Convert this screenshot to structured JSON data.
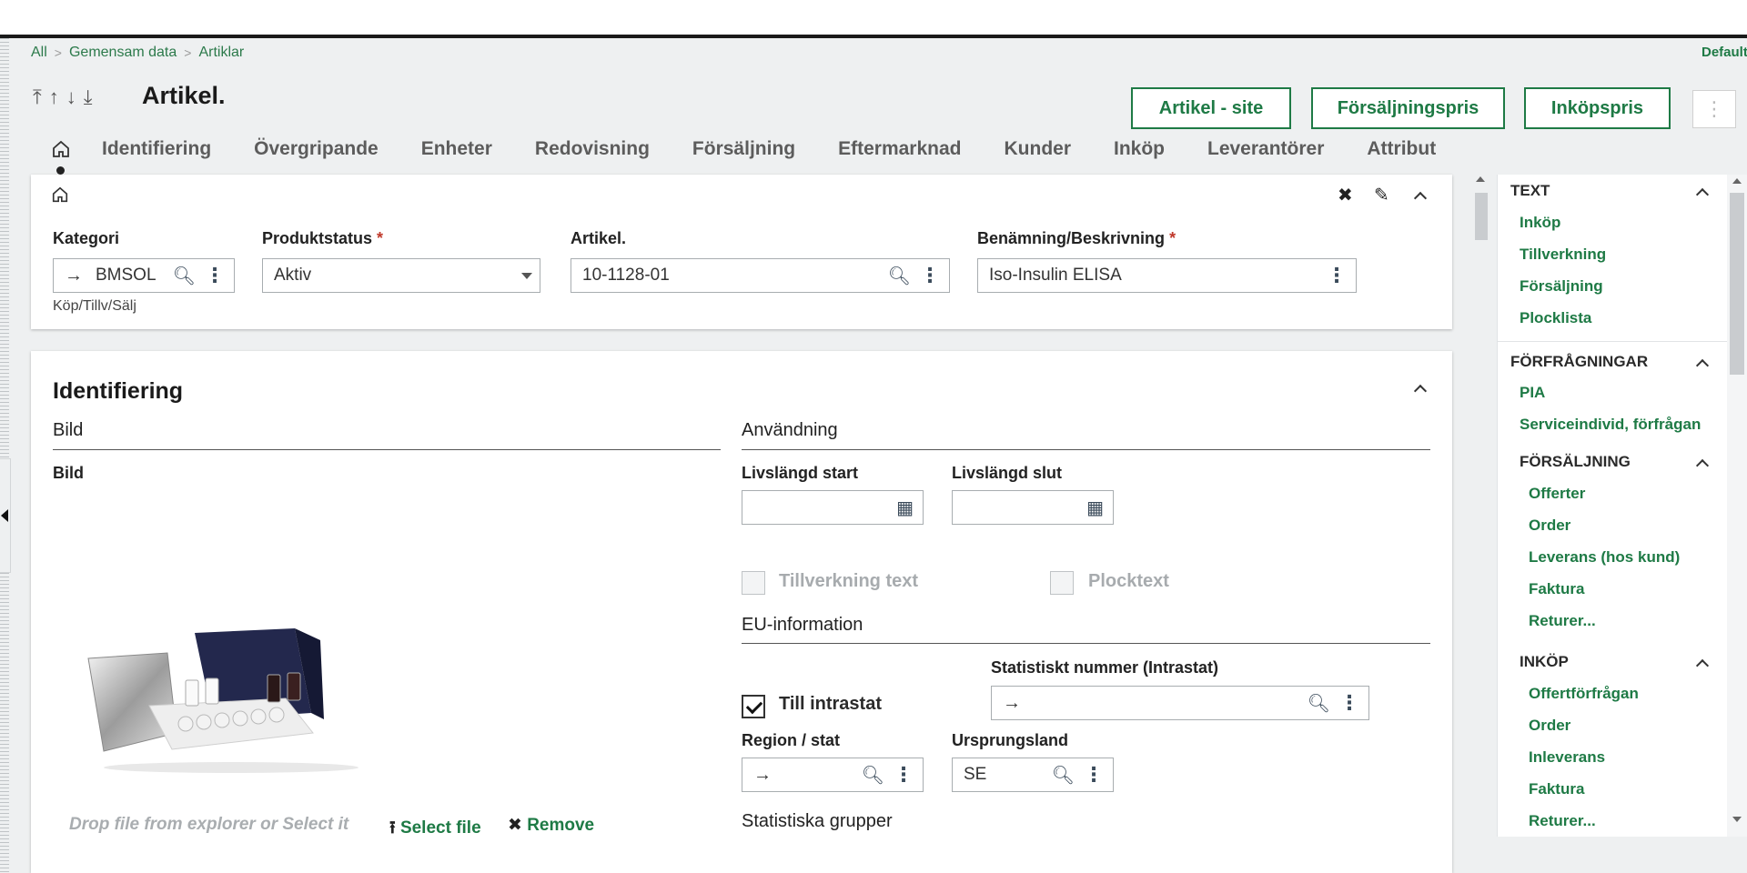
{
  "breadcrumb": [
    "All",
    "Gemensam data",
    "Artiklar"
  ],
  "top_right_label": "Default",
  "title": "Artikel.",
  "header_buttons": {
    "site": "Artikel - site",
    "forsaljningspris": "Försäljningspris",
    "inkopspris": "Inköpspris",
    "more": "⋮"
  },
  "tabs": [
    "Identifiering",
    "Övergripande",
    "Enheter",
    "Redovisning",
    "Försäljning",
    "Eftermarknad",
    "Kunder",
    "Inköp",
    "Leverantörer",
    "Attribut"
  ],
  "top_card": {
    "kategori_label": "Kategori",
    "kategori_value": "BMSOL",
    "kategori_hint": "Köp/Tillv/Sälj",
    "produktstatus_label": "Produktstatus",
    "produktstatus_value": "Aktiv",
    "artikel_label": "Artikel.",
    "artikel_value": "10-1128-01",
    "benamning_label": "Benämning/Beskrivning",
    "benamning_value": "Iso-Insulin ELISA",
    "required_mark": "*"
  },
  "identifiering": {
    "title": "Identifiering",
    "bild_section": "Bild",
    "bild_label": "Bild",
    "drop_hint": "Drop file from explorer or Select it",
    "select_file": "Select file",
    "remove": "Remove",
    "anvandning_section": "Användning",
    "livslangd_start_label": "Livslängd start",
    "livslangd_slut_label": "Livslängd slut",
    "tillverkning_text": "Tillverkning text",
    "plocktext": "Plocktext",
    "eu_section": "EU-information",
    "statistiskt_nummer_label": "Statistiskt nummer (Intrastat)",
    "till_intrastat": "Till intrastat",
    "region_label": "Region / stat",
    "ursprungsland_label": "Ursprungsland",
    "ursprungsland_value": "SE",
    "statistiska_grupper": "Statistiska grupper"
  },
  "right_panel": {
    "text_head": "TEXT",
    "text_links": [
      "Inköp",
      "Tillverkning",
      "Försäljning",
      "Plocklista"
    ],
    "forfragningar_head": "FÖRFRÅGNINGAR",
    "forfragningar_links": [
      "PIA",
      "Serviceindivid, förfrågan"
    ],
    "forsaljning_head": "FÖRSÄLJNING",
    "forsaljning_links": [
      "Offerter",
      "Order",
      "Leverans (hos kund)",
      "Faktura",
      "Returer..."
    ],
    "inkop_head": "INKÖP",
    "inkop_links": [
      "Offertförfrågan",
      "Order",
      "Inleverans",
      "Faktura",
      "Returer..."
    ]
  },
  "colors": {
    "accent": "#1e7a45",
    "required": "#c0392b",
    "background": "#eef0f1"
  }
}
